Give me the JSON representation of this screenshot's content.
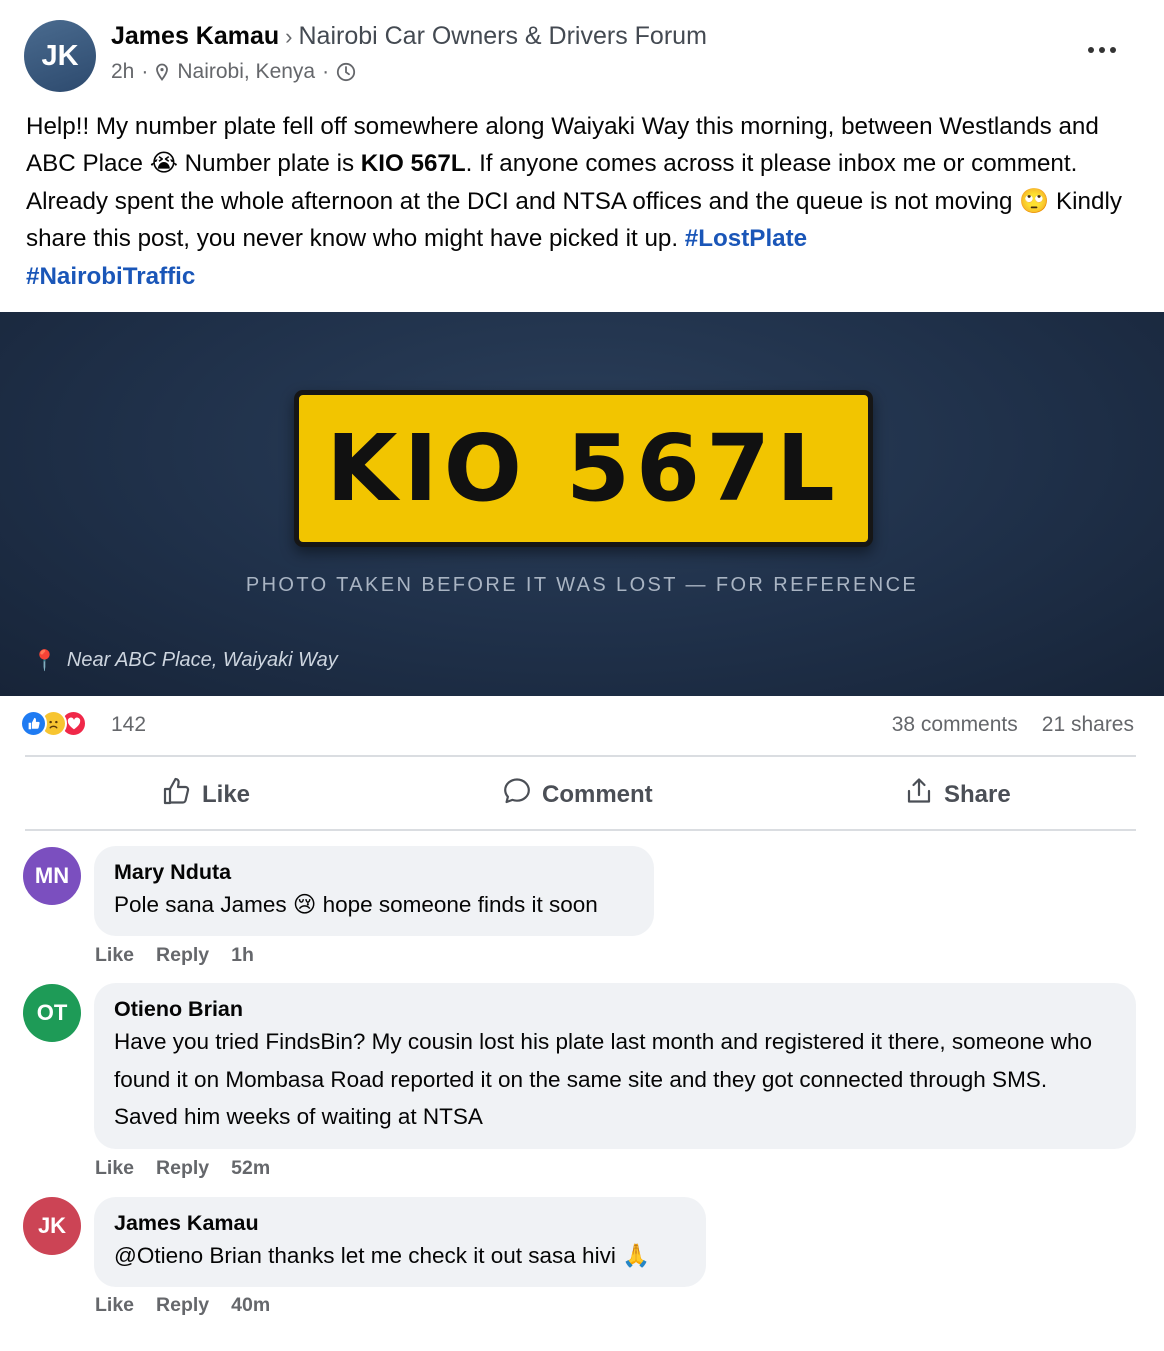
{
  "post": {
    "author_initials": "JK",
    "author": "James Kamau",
    "separator": "›",
    "group": "Nairobi Car Owners & Drivers Forum",
    "time": "2h",
    "location": "Nairobi, Kenya",
    "text": {
      "p1": "Help!! My number plate fell off somewhere along Waiyaki Way this morning, between Westlands and ABC Place ",
      "emoji1": "😭",
      "p2": " Number plate is ",
      "plate_bold": "KIO 567L",
      "p3": ". If anyone comes across it please inbox me or comment. Already spent the whole afternoon at the DCI and NTSA offices and the queue is not moving ",
      "emoji2": "🙄",
      "p4": " Kindly share this post, you never know who might have picked it up. ",
      "tag1": "#LostPlate",
      "tag2": "#NairobiTraffic"
    }
  },
  "photo": {
    "plate": "KIO 567L",
    "caption": "PHOTO TAKEN BEFORE IT WAS LOST — FOR REFERENCE",
    "location": "Near ABC Place, Waiyaki Way"
  },
  "stats": {
    "reaction_count": "142",
    "comments": "38 comments",
    "shares": "21 shares"
  },
  "actions": {
    "like": "Like",
    "comment": "Comment",
    "share": "Share"
  },
  "comments": [
    {
      "initials": "MN",
      "avatar_color": "#7b4fbf",
      "name": "Mary Nduta",
      "text_a": "Pole sana James ",
      "emoji": "😢",
      "text_b": " hope someone finds it soon",
      "like": "Like",
      "reply": "Reply",
      "time": "1h"
    },
    {
      "initials": "OT",
      "avatar_color": "#1e9b57",
      "name": "Otieno Brian",
      "text": "Have you tried FindsBin? My cousin lost his plate last month and registered it there, someone who found it on Mombasa Road reported it on the same site and they got connected through SMS. Saved him weeks of waiting at NTSA",
      "like": "Like",
      "reply": "Reply",
      "time": "52m"
    },
    {
      "initials": "JK",
      "avatar_color": "#cc4455",
      "name": "James Kamau",
      "text_a": "@Otieno Brian thanks let me check it out sasa hivi ",
      "emoji": "🙏",
      "like": "Like",
      "reply": "Reply",
      "time": "40m"
    }
  ]
}
